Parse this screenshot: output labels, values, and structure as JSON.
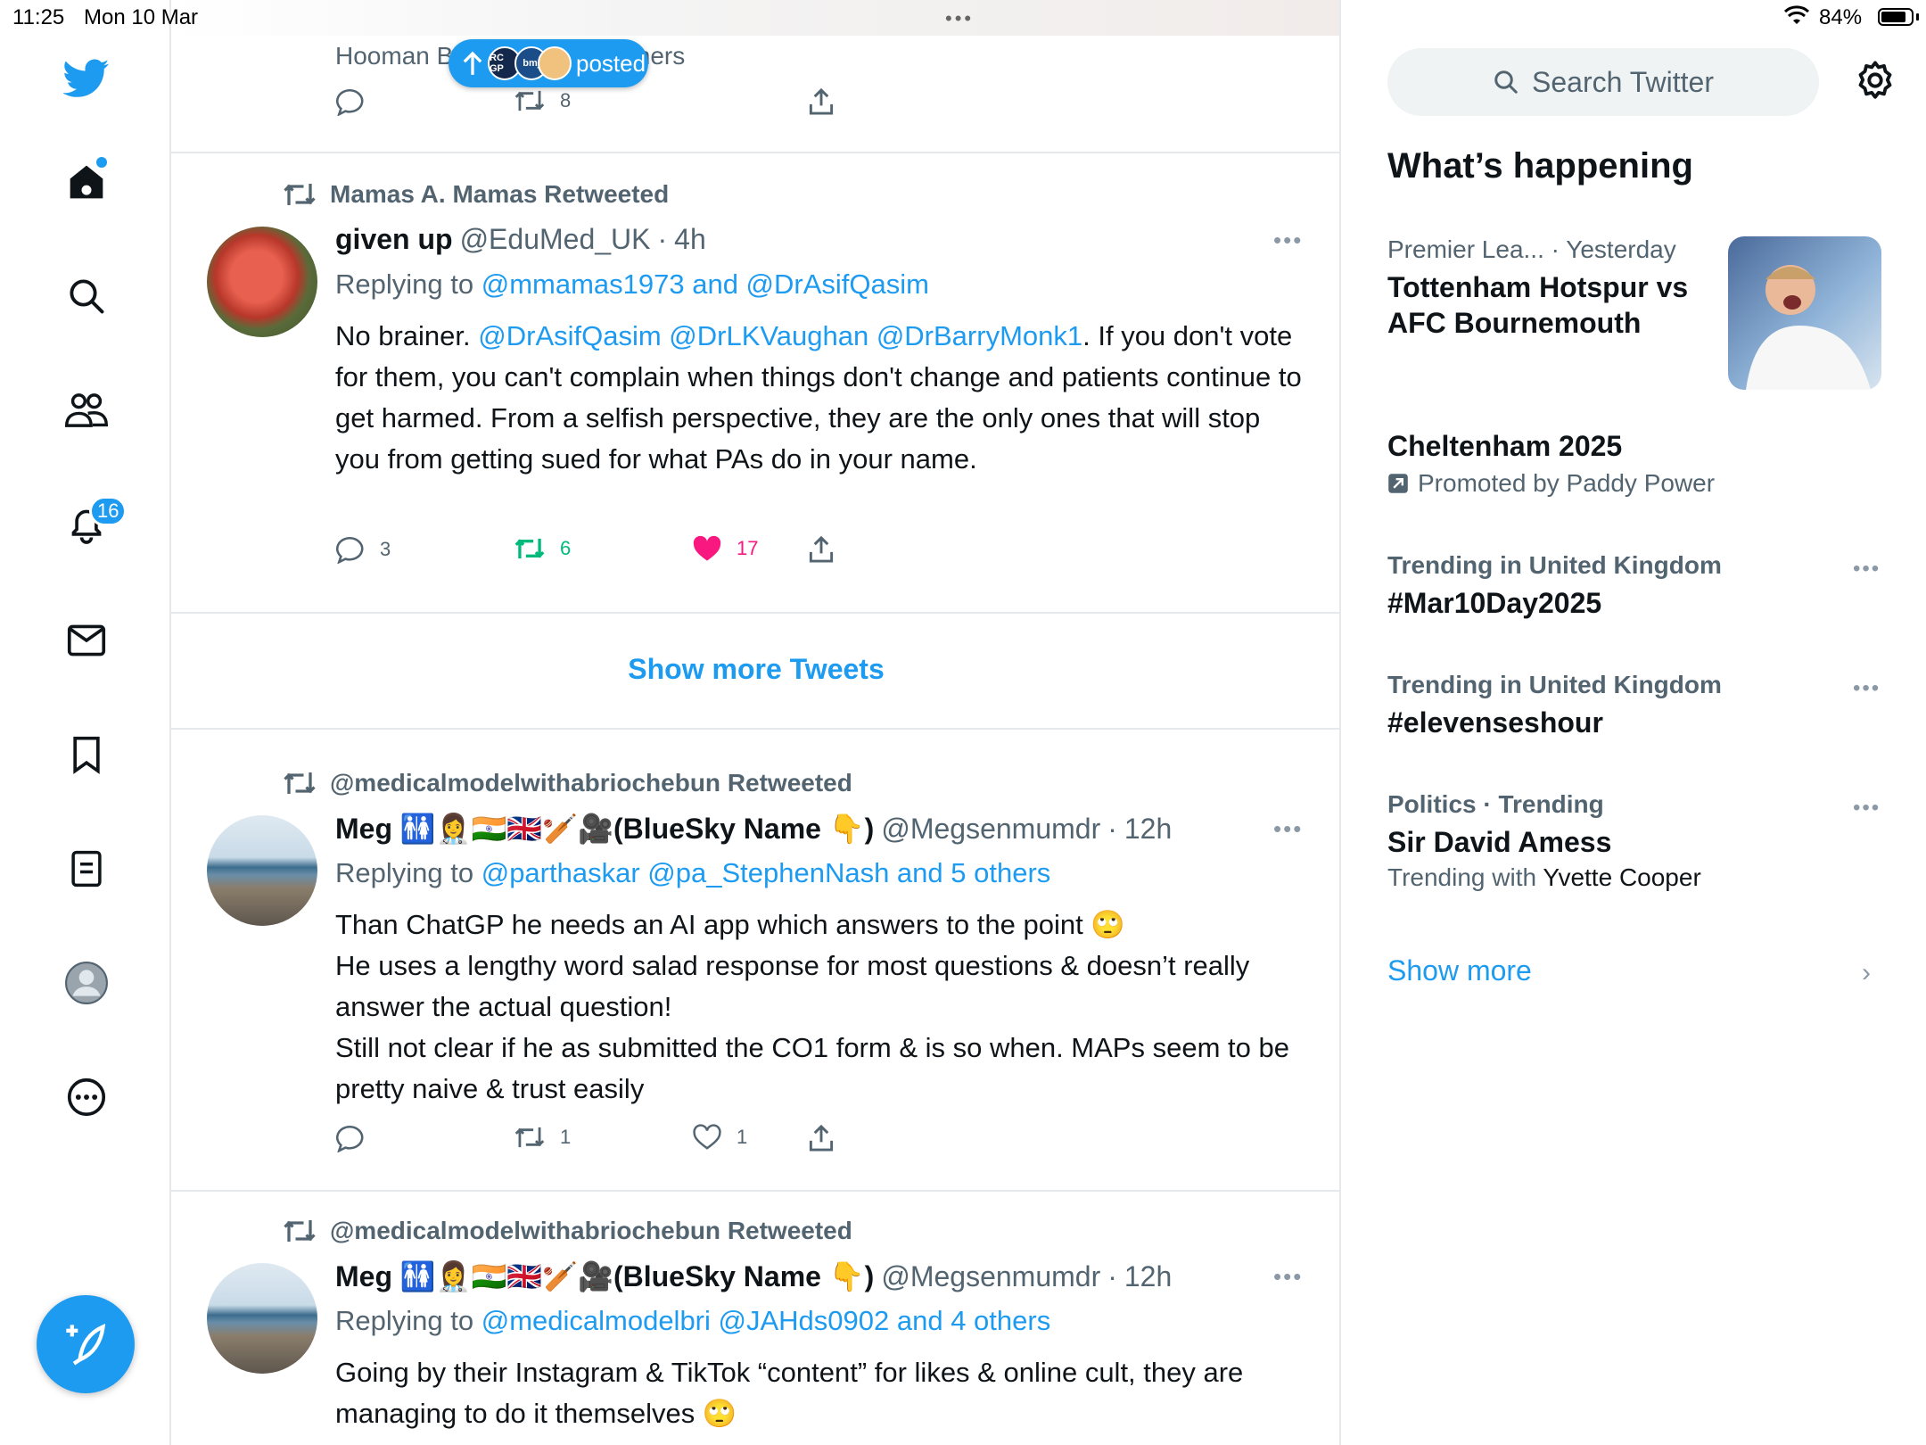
{
  "status_bar": {
    "time": "11:25",
    "date": "Mon 10 Mar",
    "battery": "84%",
    "battery_level": 0.84
  },
  "nav": {
    "notifications_badge": "16"
  },
  "pill": {
    "label": "posted",
    "avatars": [
      "RC GP",
      "bmj",
      ""
    ]
  },
  "top_tweet": {
    "liked_by": "Hooman Bakhshi and 29 others",
    "retweets": "8"
  },
  "tweets": [
    {
      "retweeted_by": "Mamas A. Mamas Retweeted",
      "name": "given up",
      "handle": "@EduMed_UK",
      "sep": "·",
      "time": "4h",
      "replying_prefix": "Replying to",
      "replying_links": "@mmamas1973 and @DrAsifQasim",
      "body_prefix": "No brainer.",
      "body_mentions": "@DrAsifQasim @DrLKVaughan @DrBarryMonk1",
      "body_rest": ". If you don't vote for them, you can't complain when things don't change and patients continue to get harmed. From a selfish perspective, they are the only ones that will stop you from getting sued for what PAs do in your name.",
      "replies": "3",
      "retweets": "6",
      "likes": "17"
    },
    {
      "retweeted_by": "@medicalmodelwithabriochebun Retweeted",
      "name": "Meg 🚻👩‍⚕️🇮🇳🇬🇧🏏🎥(BlueSky Name 👇)",
      "handle": "@Megsenmumdr",
      "sep": "·",
      "time": "12h",
      "replying_prefix": "Replying to",
      "replying_links": "@parthaskar @pa_StephenNash and 5 others",
      "body_lines": [
        "Than ChatGP he needs an AI app which answers to the point 🙄",
        "He uses a lengthy word salad response for most questions & doesn’t really answer the actual question!",
        "Still not clear if he as submitted the CO1 form & is so when. MAPs seem to be pretty naive & trust easily"
      ],
      "retweets": "1",
      "likes": "1"
    },
    {
      "retweeted_by": "@medicalmodelwithabriochebun Retweeted",
      "name": "Meg 🚻👩‍⚕️🇮🇳🇬🇧🏏🎥(BlueSky Name 👇)",
      "handle": "@Megsenmumdr",
      "sep": "·",
      "time": "12h",
      "replying_prefix": "Replying to",
      "replying_links": "@medicalmodelbri @JAHds0902 and 4 others",
      "body": "Going by their Instagram & TikTok “content” for likes & online cult, they are managing to do it themselves 🙄"
    }
  ],
  "show_more_tweets": "Show more Tweets",
  "sidebar": {
    "search_placeholder": "Search Twitter",
    "whats_happening": "What’s happening",
    "trends": [
      {
        "category": "Premier Lea...",
        "time": "· Yesterday",
        "title": "Tottenham Hotspur vs AFC Bournemouth"
      },
      {
        "title": "Cheltenham 2025",
        "promoted": "Promoted by Paddy Power"
      },
      {
        "category": "Trending in United Kingdom",
        "title": "#Mar10Day2025"
      },
      {
        "category": "Trending in United Kingdom",
        "title": "#elevenseshour"
      },
      {
        "category": "Politics · Trending",
        "title": "Sir David Amess",
        "sub_prefix": "Trending with",
        "sub_name": "Yvette Cooper"
      }
    ],
    "show_more": "Show more"
  },
  "colors": {
    "accent": "#1d9bf0",
    "retweet_green": "#00ba7c",
    "like_pink": "#f91880",
    "muted": "#536471"
  }
}
